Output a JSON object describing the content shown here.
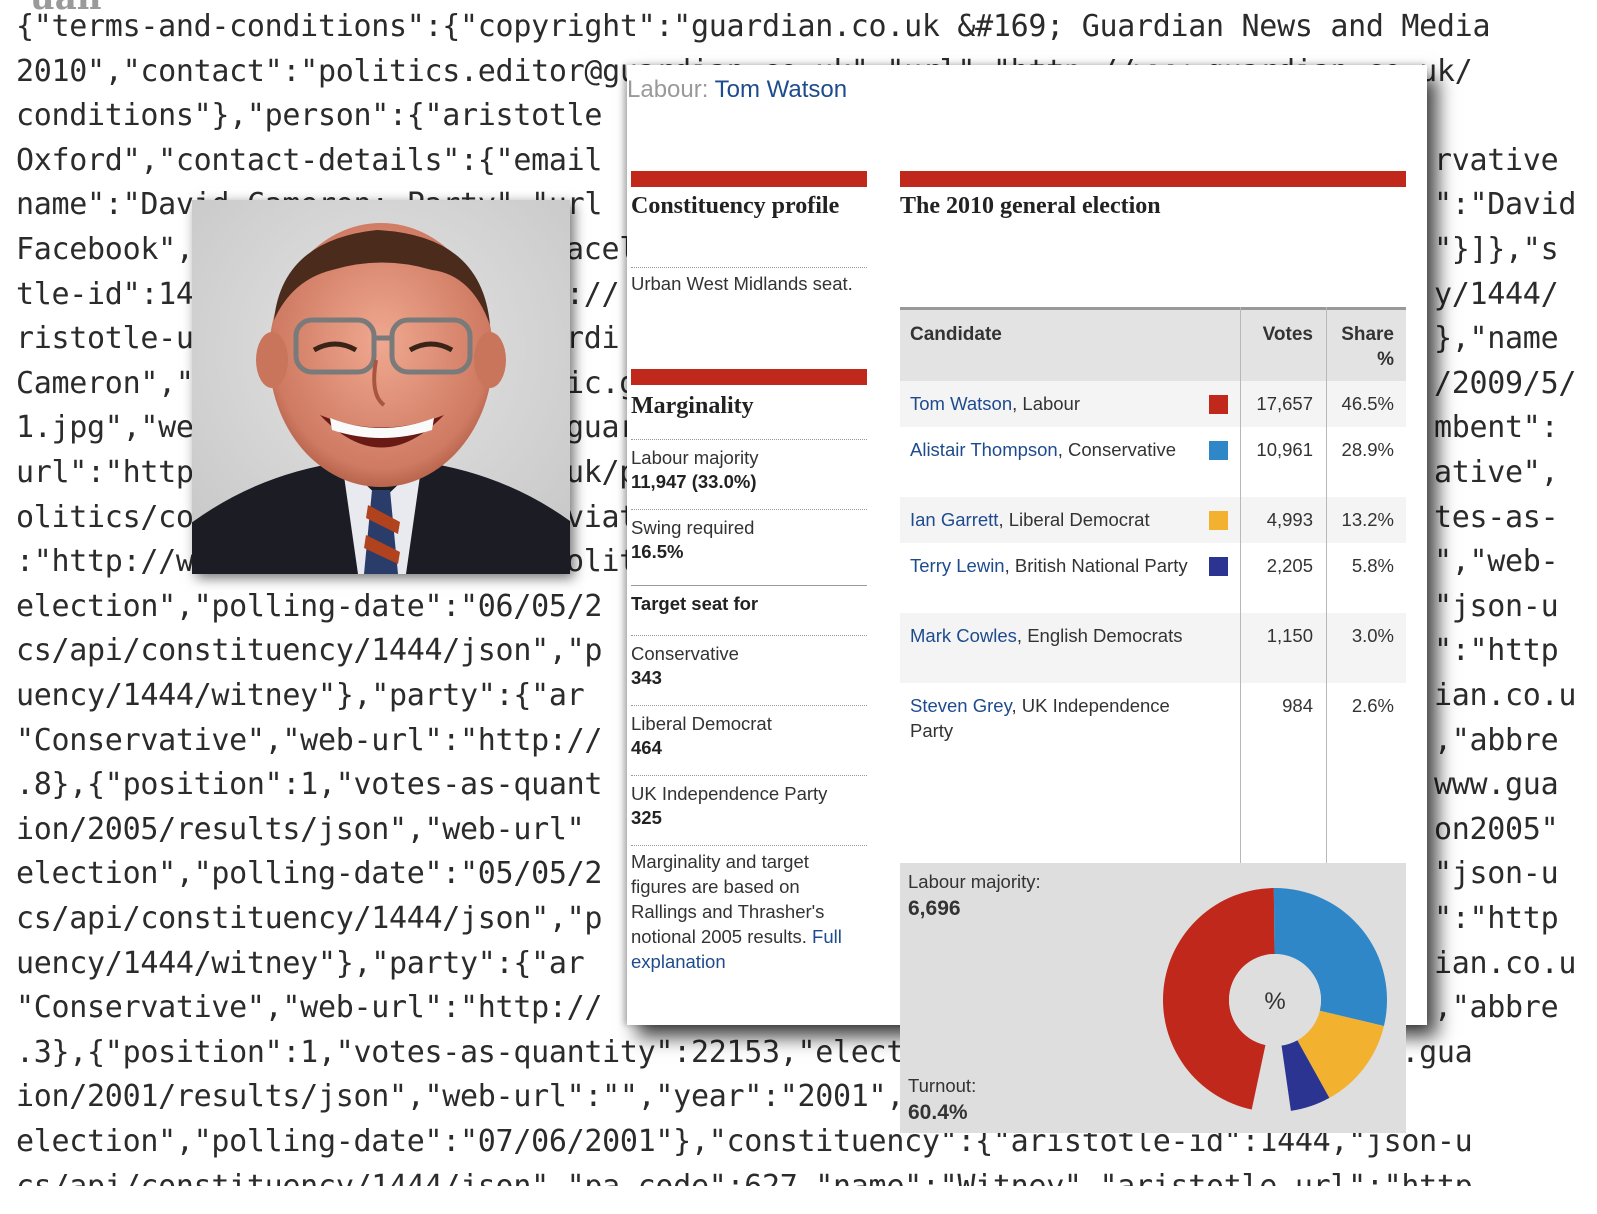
{
  "json_background": {
    "top_fragment": "uan",
    "lines": [
      "{\"terms-and-conditions\":{\"copyright\":\"guardian.co.uk &#169; Guardian News and Media",
      "2010\",\"contact\":\"politics.editor@guardian.co.uk\",\"url\":\"http://www.guardian.co.uk/",
      "conditions\"},\"person\":{\"aristotle",
      "Oxford\",\"contact-details\":{\"email",
      "name\":\"David Cameron: Party\",\"url",
      "Facebook\",",
      "tle-id\":14",
      "ristotle-u",
      "Cameron\",\"",
      "1.jpg\",\"we",
      "url\":\"http",
      "olitics/co",
      ":\"http://w",
      "election\",\"polling-date\":\"06/05/2",
      "cs/api/constituency/1444/json\",\"p",
      "uency/1444/witney\"},\"party\":{\"ar",
      "\"Conservative\",\"web-url\":\"http://",
      ".8},{\"position\":1,\"votes-as-quant",
      "ion/2005/results/json\",\"web-url\"",
      "election\",\"polling-date\":\"05/05/2",
      "cs/api/constituency/1444/json\",\"p",
      "uency/1444/witney\"},\"party\":{\"ar",
      "\"Conservative\",\"web-url\":\"http://",
      ".3},{\"position\":1,\"votes-as-quantity\":22153,\"election\":{\"json-url\":\"http://www.gua",
      "ion/2001/results/json\",\"web-url\":\"\",\"year\":\"2001\",\"type\":\"general",
      "election\",\"polling-date\":\"07/06/2001\"},\"constituency\":{\"aristotle-id\":1444,\"json-u",
      "cs/api/constituency/1444/json\",\"pa_code\":627,\"name\":\"Witney\",\"aristotle-url\":\"http"
    ],
    "right_fragments": [
      "rvative",
      "\":\"David",
      "\"}]},\"s",
      "y/1444/",
      "},\"name",
      "/2009/5/",
      "mbent\":",
      "ative\",",
      "tes-as-",
      "\",\"web-",
      "\"json-u",
      "\":\"http",
      "ian.co.u",
      ",\"abbre",
      "www.gua",
      "on2005\"",
      "\"json-u",
      "\":\"http",
      "ian.co.u",
      ",\"abbre"
    ],
    "mid_fragments": [
      "acel",
      "://",
      "rdi",
      "ic.g",
      "guar",
      "uk/p",
      "viat",
      "olit"
    ]
  },
  "panel": {
    "header_prefix": "Labour: ",
    "header_name": "Tom Watson",
    "profile": {
      "title": "Constituency profile",
      "description": "Urban West Midlands seat."
    },
    "marginality": {
      "title": "Marginality",
      "majority_label": "Labour majority",
      "majority_value": "11,947 (33.0%)",
      "swing_label": "Swing required",
      "swing_value": "16.5%",
      "target_title": "Target seat for",
      "targets": [
        {
          "party": "Conservative",
          "rank": "343"
        },
        {
          "party": "Liberal Democrat",
          "rank": "464"
        },
        {
          "party": "UK Independence Party",
          "rank": "325"
        }
      ],
      "note_text": "Marginality and target figures are based on Rallings and Thrasher's notional 2005 results. ",
      "note_link": "Full explanation"
    },
    "results": {
      "title": "The 2010 general election",
      "headers": {
        "candidate": "Candidate",
        "votes": "Votes",
        "share_line1": "Share",
        "share_line2": "%"
      },
      "rows": [
        {
          "name": "Tom Watson",
          "party": ", Labour",
          "color": "#c0281c",
          "votes": "17,657",
          "share": "46.5%"
        },
        {
          "name": "Alistair Thompson",
          "party": ", Conservative",
          "color": "#2f87c8",
          "votes": "10,961",
          "share": "28.9%"
        },
        {
          "name": "Ian Garrett",
          "party": ", Liberal Democrat",
          "color": "#f2b230",
          "votes": "4,993",
          "share": "13.2%"
        },
        {
          "name": "Terry Lewin",
          "party": ", British National Party",
          "color": "#2b3591",
          "votes": "2,205",
          "share": "5.8%"
        },
        {
          "name": "Mark Cowles",
          "party": ", English Democrats",
          "color": "",
          "votes": "1,150",
          "share": "3.0%"
        },
        {
          "name": "Steven Grey",
          "party": ", UK Independence Party",
          "color": "",
          "votes": "984",
          "share": "2.6%"
        }
      ],
      "summary": {
        "majority_label": "Labour majority:",
        "majority_value": "6,696",
        "turnout_label": "Turnout:",
        "turnout_value": "60.4%",
        "donut_center": "%"
      }
    }
  },
  "chart_data": {
    "type": "pie",
    "categories": [
      "Labour",
      "Conservative",
      "Liberal Democrat",
      "British National Party",
      "English Democrats",
      "UK Independence Party"
    ],
    "values": [
      46.5,
      28.9,
      13.2,
      5.8,
      3.0,
      2.6
    ],
    "colors": [
      "#c0281c",
      "#2f87c8",
      "#f2b230",
      "#2b3591",
      "#dedede",
      "#dedede"
    ],
    "center_label": "%"
  }
}
